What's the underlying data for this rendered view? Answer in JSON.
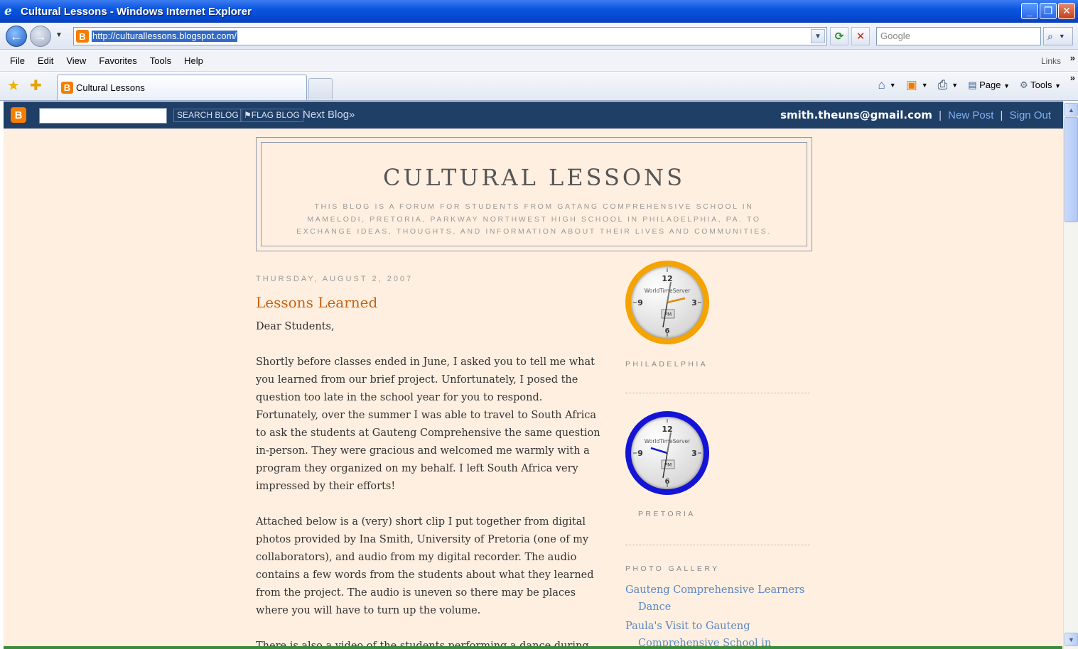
{
  "window": {
    "title": "Cultural Lessons - Windows Internet Explorer"
  },
  "address": {
    "url": "http://culturallessons.blogspot.com/",
    "search_placeholder": "Google"
  },
  "menu": {
    "items": [
      "File",
      "Edit",
      "View",
      "Favorites",
      "Tools",
      "Help"
    ],
    "links": "Links"
  },
  "tab": {
    "title": "Cultural Lessons"
  },
  "commandbar": {
    "page": "Page",
    "tools": "Tools"
  },
  "blogger_navbar": {
    "search_label": "SEARCH BLOG",
    "flag_label": "FLAG BLOG",
    "next_label": "Next Blog»",
    "email": "smith.theuns@gmail.com",
    "new_post": "New Post",
    "sign_out": "Sign Out",
    "separator": "|"
  },
  "blog": {
    "title": "CULTURAL LESSONS",
    "description": "This blog is a forum for students from Gatang Comprehensive School in Mamelodi, Pretoria, Parkway Northwest High School in Philadelphia, PA. to exchange ideas, thoughts, and information about their lives and communities."
  },
  "post": {
    "date": "THURSDAY, AUGUST 2, 2007",
    "title": "Lessons Learned",
    "paragraphs": [
      "Dear Students,",
      "Shortly before classes ended in June, I asked you to tell me what you learned from our brief project. Unfortunately, I posed the question too late in the school year for you to respond. Fortunately, over the summer I was able to travel to South Africa to ask the students at Gauteng Comprehensive the same question in-person. They were gracious and welcomed me warmly with a program they organized on my behalf. I left South Africa very impressed by their efforts!",
      "Attached below is a (very) short clip I put together from digital photos provided by Ina Smith, University of Pretoria (one of my collaborators), and audio from my digital recorder. The audio contains a few words from the students about what they learned from the project. The audio is uneven so there may be places where you will have to turn up the volume.",
      "There is also a video of the students performing a dance during"
    ]
  },
  "sidebar": {
    "clocks": [
      {
        "label": "PHILADELPHIA",
        "brand": "WorldTimeServer",
        "ampm": "PM",
        "numerals": [
          "12",
          "3",
          "6",
          "9"
        ],
        "ring_color": "#f5a300"
      },
      {
        "label": "PRETORIA",
        "brand": "WorldTimeServer",
        "ampm": "PM",
        "numerals": [
          "12",
          "3",
          "6",
          "9"
        ],
        "ring_color": "#1414d6"
      }
    ],
    "gallery_title": "PHOTO GALLERY",
    "gallery_items": [
      "Gauteng Comprehensive Learners Dance",
      "Paula's Visit to Gauteng Comprehensive School in"
    ]
  },
  "colors": {
    "navbar": "#1f3f67",
    "page_bg": "#ffefe0",
    "post_title": "#c76215",
    "link": "#5a87c4"
  }
}
